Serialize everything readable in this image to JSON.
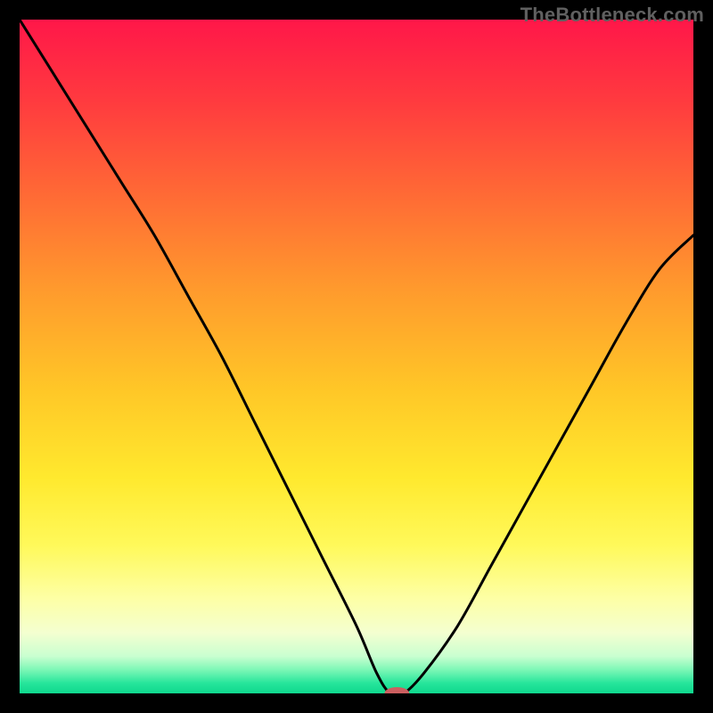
{
  "watermark": "TheBottleneck.com",
  "chart_data": {
    "type": "line",
    "title": "",
    "xlabel": "",
    "ylabel": "",
    "xlim": [
      0,
      100
    ],
    "ylim": [
      0,
      100
    ],
    "grid": false,
    "legend": false,
    "series": [
      {
        "name": "bottleneck-curve",
        "x": [
          0,
          5,
          10,
          15,
          20,
          25,
          30,
          35,
          40,
          45,
          50,
          53,
          55,
          57,
          60,
          65,
          70,
          75,
          80,
          85,
          90,
          95,
          100
        ],
        "y": [
          100,
          92,
          84,
          76,
          68,
          59,
          50,
          40,
          30,
          20,
          10,
          3,
          0,
          0,
          3,
          10,
          19,
          28,
          37,
          46,
          55,
          63,
          68
        ]
      }
    ],
    "marker": {
      "x": 56,
      "y": 0,
      "color": "#cb5f60",
      "rx": 14,
      "ry": 7
    },
    "background_gradient": {
      "stops": [
        {
          "offset": 0.0,
          "color": "#ff1749"
        },
        {
          "offset": 0.12,
          "color": "#ff3a3f"
        },
        {
          "offset": 0.26,
          "color": "#ff6a35"
        },
        {
          "offset": 0.4,
          "color": "#ff9a2d"
        },
        {
          "offset": 0.55,
          "color": "#ffc727"
        },
        {
          "offset": 0.68,
          "color": "#ffe92e"
        },
        {
          "offset": 0.78,
          "color": "#fff95a"
        },
        {
          "offset": 0.86,
          "color": "#fdffa6"
        },
        {
          "offset": 0.91,
          "color": "#f4ffd0"
        },
        {
          "offset": 0.945,
          "color": "#c9ffd0"
        },
        {
          "offset": 0.965,
          "color": "#7cf7b6"
        },
        {
          "offset": 0.985,
          "color": "#26e59b"
        },
        {
          "offset": 1.0,
          "color": "#0fd88d"
        }
      ]
    }
  }
}
